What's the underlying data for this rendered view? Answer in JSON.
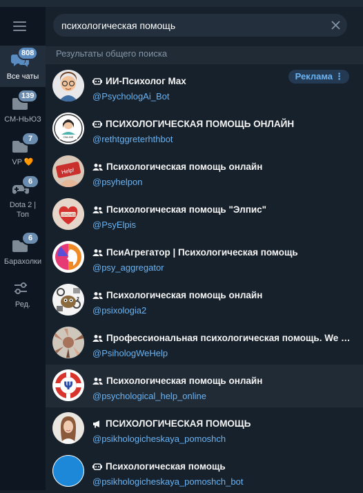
{
  "sidebar": {
    "folders": [
      {
        "label": "Все чаты",
        "badge": "808",
        "icon": "chats-icon"
      },
      {
        "label": "СМ-НЬЮЗ",
        "badge": "139",
        "icon": "folder-icon"
      },
      {
        "label": "VP 🧡",
        "badge": "7",
        "icon": "folder-icon"
      },
      {
        "label": "Dota 2 | Топ",
        "badge": "6",
        "icon": "gamepad-icon"
      },
      {
        "label": "Барахолки",
        "badge": "6",
        "icon": "folder-icon"
      },
      {
        "label": "Ред.",
        "badge": "",
        "icon": "edit-filters-icon"
      }
    ]
  },
  "search": {
    "value": "психологическая помощь"
  },
  "section_header": "Результаты общего поиска",
  "results": [
    {
      "type": "bot",
      "title": "ИИ-Психолог Max",
      "username": "@PsychologAi_Bot",
      "ad": "Реклама"
    },
    {
      "type": "bot",
      "title": "ПСИХОЛОГИЧЕСКАЯ ПОМОЩЬ ОНЛАЙН",
      "username": "@rethtggreterhthbot"
    },
    {
      "type": "group",
      "title": "Психологическая помощь онлайн",
      "username": "@psyhelpon"
    },
    {
      "type": "group",
      "title": "Психологическая помощь \"Элпис\"",
      "username": "@PsyElpis"
    },
    {
      "type": "group",
      "title": "ПсиАгрегатор | Психологическая помощь",
      "username": "@psy_aggregator"
    },
    {
      "type": "group",
      "title": "Психологическая помощь онлайн",
      "username": "@psixologia2"
    },
    {
      "type": "group",
      "title": "Профессиональная психологическая помощь. We Help",
      "username": "@PsihologWeHelp"
    },
    {
      "type": "group",
      "title": "Психологическая помощь онлайн",
      "username": "@psychological_help_online"
    },
    {
      "type": "channel",
      "title": "ПСИХОЛОГИЧЕСКАЯ ПОМОЩЬ",
      "username": "@psikhologicheskaya_pomoshch"
    },
    {
      "type": "bot",
      "title": "Психологическая помощь",
      "username": "@psikhologicheskaya_pomoshch_bot"
    }
  ],
  "colors": {
    "background": "#17212b",
    "sidebar": "#0e1621",
    "accent": "#6ab3f3",
    "badge": "#6a8caf"
  }
}
